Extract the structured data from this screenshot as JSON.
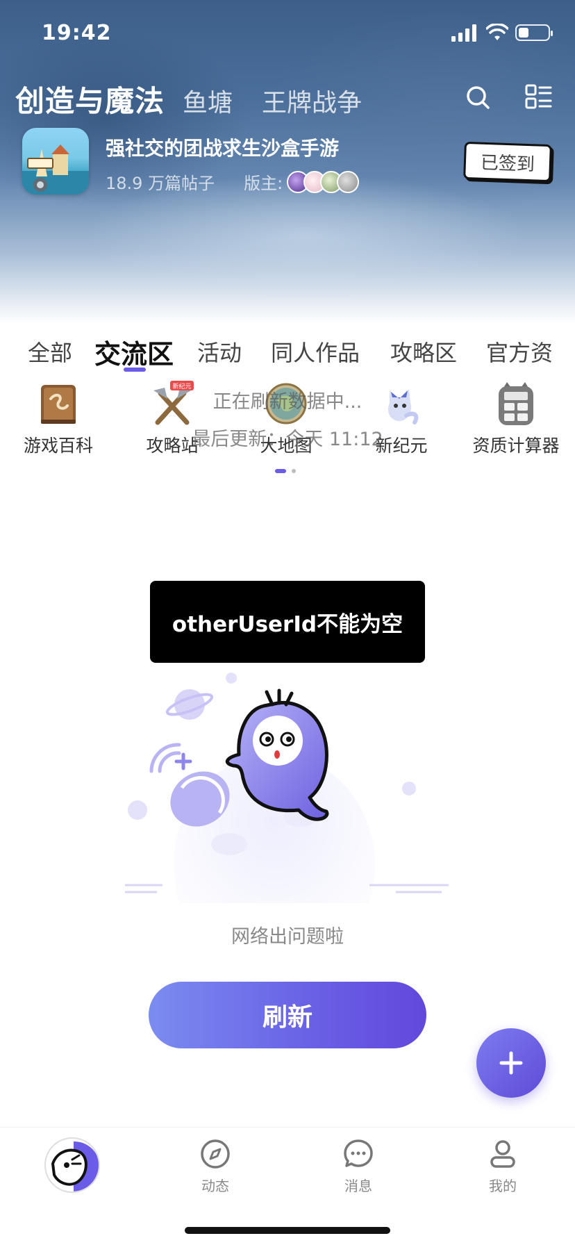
{
  "status_bar": {
    "time": "19:42"
  },
  "header": {
    "title": "创造与魔法",
    "alt_titles": [
      "鱼塘",
      "王牌战争"
    ],
    "game": {
      "description": "强社交的团战求生沙盒手游",
      "posts": "18.9 万篇帖子",
      "moderator_label": "版主:",
      "checkin_label": "已签到"
    }
  },
  "tabs": [
    "全部",
    "交流区",
    "活动",
    "同人作品",
    "攻略区",
    "官方资"
  ],
  "active_tab": "交流区",
  "shortcuts": [
    {
      "label": "游戏百科",
      "icon": "encyclopedia-book-icon"
    },
    {
      "label": "攻略站",
      "icon": "crossed-tools-icon",
      "badge": "新纪元"
    },
    {
      "label": "大地图",
      "icon": "world-map-icon"
    },
    {
      "label": "新纪元",
      "icon": "fox-mascot-icon"
    },
    {
      "label": "资质计算器",
      "icon": "calculator-icon"
    }
  ],
  "refresh_overlay": {
    "line1": "正在刷新数据中...",
    "line2": "最后更新：今天 11:12"
  },
  "toast": "otherUserId不能为空",
  "empty_state": {
    "message": "网络出问题啦",
    "button_label": "刷新"
  },
  "bottom_nav": [
    {
      "label": "",
      "icon": "home-fish-icon"
    },
    {
      "label": "动态",
      "icon": "compass-icon"
    },
    {
      "label": "消息",
      "icon": "chat-bubble-icon"
    },
    {
      "label": "我的",
      "icon": "profile-icon"
    }
  ],
  "colors": {
    "accent": "#6b5ce7",
    "button_gradient_start": "#7b8cf0",
    "button_gradient_end": "#6248dc"
  }
}
